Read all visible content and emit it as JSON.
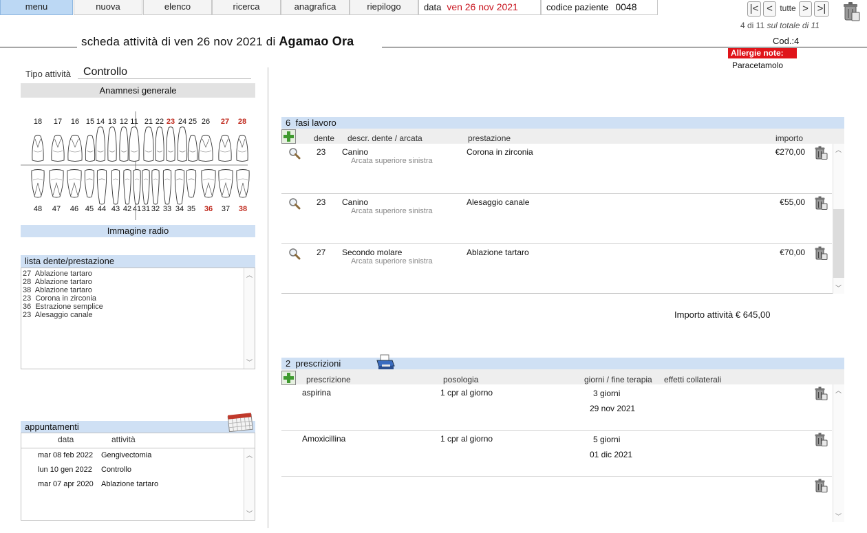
{
  "nav": {
    "menu": "menu",
    "nuova": "nuova",
    "elenco": "elenco",
    "ricerca": "ricerca",
    "anagrafica": "anagrafica",
    "riepilogo": "riepilogo",
    "data_label": "data",
    "data_value": "ven 26 nov 2021",
    "codice_label": "codice paziente",
    "codice_value": "0048"
  },
  "pager": {
    "first": "|<",
    "prev": "<",
    "all": "tutte",
    "next": ">",
    "last": ">|",
    "position": "4 di 11",
    "total": "sul totale di 11"
  },
  "header": {
    "title_prefix": "scheda attività di ven 26 nov 2021 di",
    "patient_name": "Agamao Ora",
    "cod": "Cod.:4",
    "allergie_label": "Allergie note:",
    "allergie_value": "Paracetamolo"
  },
  "left": {
    "tipo_label": "Tipo attività",
    "tipo_value": "Controllo",
    "anamnesi": "Anamnesi generale",
    "upper_teeth": [
      {
        "n": "18",
        "red": false
      },
      {
        "n": "17",
        "red": false
      },
      {
        "n": "16",
        "red": false
      },
      {
        "n": "15",
        "red": false
      },
      {
        "n": "14",
        "red": false
      },
      {
        "n": "13",
        "red": false
      },
      {
        "n": "12",
        "red": false
      },
      {
        "n": "11",
        "red": false
      },
      {
        "n": "21",
        "red": false
      },
      {
        "n": "22",
        "red": false
      },
      {
        "n": "23",
        "red": true
      },
      {
        "n": "24",
        "red": false
      },
      {
        "n": "25",
        "red": false
      },
      {
        "n": "26",
        "red": false
      },
      {
        "n": "27",
        "red": true
      },
      {
        "n": "28",
        "red": true
      }
    ],
    "lower_teeth": [
      {
        "n": "48",
        "red": false
      },
      {
        "n": "47",
        "red": false
      },
      {
        "n": "46",
        "red": false
      },
      {
        "n": "45",
        "red": false
      },
      {
        "n": "44",
        "red": false
      },
      {
        "n": "43",
        "red": false
      },
      {
        "n": "42",
        "red": false
      },
      {
        "n": "41",
        "red": false
      },
      {
        "n": "31",
        "red": false
      },
      {
        "n": "32",
        "red": false
      },
      {
        "n": "33",
        "red": false
      },
      {
        "n": "34",
        "red": false
      },
      {
        "n": "35",
        "red": false
      },
      {
        "n": "36",
        "red": true
      },
      {
        "n": "37",
        "red": false
      },
      {
        "n": "38",
        "red": true
      }
    ],
    "immagine_radio": "Immagine radio",
    "lista_title": "lista dente/prestazione",
    "lista_items": [
      "27  Ablazione tartaro",
      "28  Ablazione tartaro",
      "38  Ablazione tartaro",
      "23  Corona in zirconia",
      "36  Estrazione semplice",
      "23  Alesaggio canale"
    ],
    "appuntamenti_title": "appuntamenti",
    "app_col_data": "data",
    "app_col_attivita": "attività",
    "appuntamenti": [
      {
        "data": "mar 08 feb 2022",
        "attivita": "Gengivectomia"
      },
      {
        "data": "lun 10 gen 2022",
        "attivita": "Controllo"
      },
      {
        "data": "mar 07 apr 2020",
        "attivita": "Ablazione tartaro"
      }
    ]
  },
  "fasi": {
    "count": "6",
    "title": "fasi lavoro",
    "col_dente": "dente",
    "col_descr": "descr. dente / arcata",
    "col_prestazione": "prestazione",
    "col_importo": "importo",
    "rows": [
      {
        "dente": "23",
        "descr": "Canino",
        "arcata": "Arcata superiore sinistra",
        "prestazione": "Corona in zirconia",
        "importo": "€270,00"
      },
      {
        "dente": "23",
        "descr": "Canino",
        "arcata": "Arcata superiore sinistra",
        "prestazione": "Alesaggio canale",
        "importo": "€55,00"
      },
      {
        "dente": "27",
        "descr": "Secondo molare",
        "arcata": "Arcata superiore sinistra",
        "prestazione": "Ablazione tartaro",
        "importo": "€70,00"
      }
    ],
    "importo_totale": "Importo attività € 645,00"
  },
  "prescrizioni": {
    "count": "2",
    "title": "prescrizioni",
    "col_prescrizione": "prescrizione",
    "col_posologia": "posologia",
    "col_giorni": "giorni / fine terapia",
    "col_effetti": "effetti collaterali",
    "rows": [
      {
        "prescrizione": "aspirina",
        "posologia": "1 cpr al giorno",
        "giorni": "3 giorni",
        "fine": "29 nov 2021"
      },
      {
        "prescrizione": "Amoxicillina",
        "posologia": "1 cpr al giorno",
        "giorni": "5 giorni",
        "fine": "01 dic 2021"
      }
    ]
  },
  "colors": {
    "accent_blue": "#cfe0f4",
    "menu_active": "#bcd8f4",
    "red": "#c8141e",
    "allergy_bg": "#e0141a"
  }
}
